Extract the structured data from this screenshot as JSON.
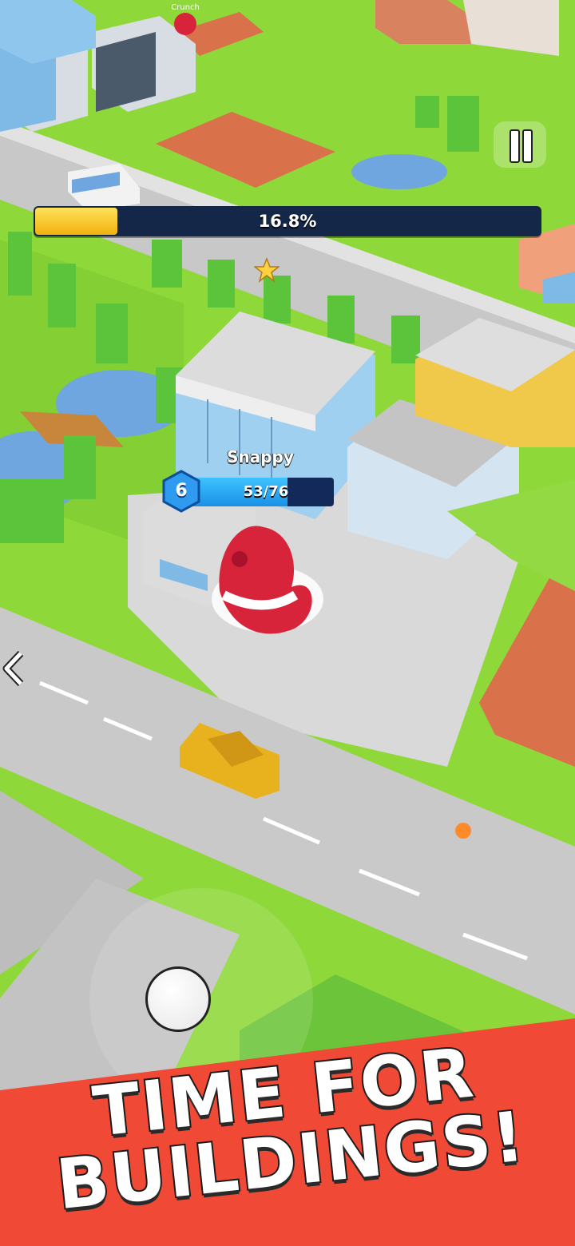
{
  "hud": {
    "progress_percent": 16.8,
    "progress_label": "16.8%",
    "pause_icon": "pause-icon",
    "back_icon": "chevron-left-icon",
    "star_icon": "star-icon"
  },
  "player": {
    "name": "Snappy",
    "level": "6",
    "hp_label": "53/76",
    "hp_current": 53,
    "hp_max": 76
  },
  "scene": {
    "rival_name": "Crunch"
  },
  "banner": {
    "line1": "TIME FOR",
    "line2": "BUILDINGS!",
    "color": "#f04a36"
  },
  "colors": {
    "progress_fill": "#f2b10e",
    "hp_fill": "#1a90e6",
    "bar_background": "#152748",
    "grass": "#8fd83a",
    "road": "#c9c9c9",
    "tennis_court": "#d9714a",
    "water": "#6fa6e0",
    "monster": "#d8243b"
  }
}
